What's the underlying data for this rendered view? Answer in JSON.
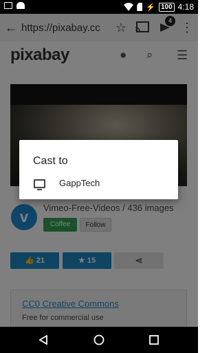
{
  "status": {
    "time": "4:18",
    "battery": "100"
  },
  "toolbar": {
    "url": "https://pixabay.cc",
    "tab_count": "4"
  },
  "site": {
    "logo": "pixabay",
    "channel_text": "Vimeo-Free-Videos / 436 images",
    "coffee_label": "Coffee",
    "follow_label": "Follow",
    "likes": "21",
    "favorites": "15",
    "license_title": "CC0 Creative Commons",
    "license_sub": "Free for commercial use"
  },
  "dialog": {
    "title": "Cast to",
    "devices": [
      {
        "name": "GappTech",
        "icon": "tv-icon"
      }
    ]
  }
}
